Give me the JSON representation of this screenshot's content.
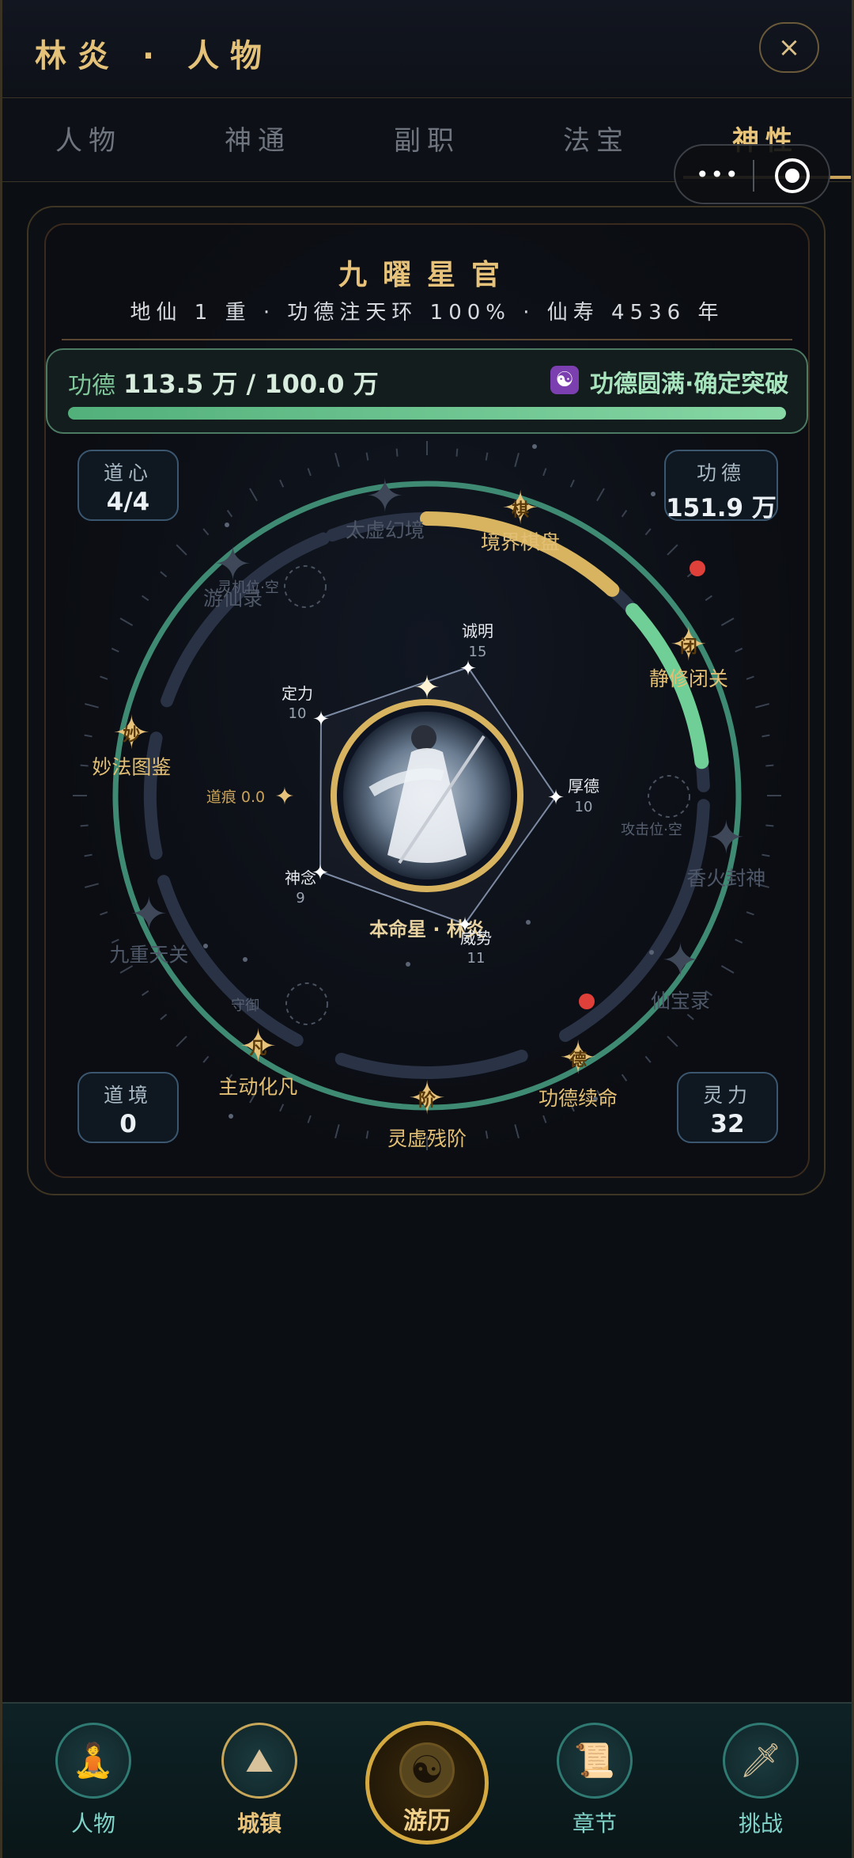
{
  "header": {
    "title": "林炎 · 人物",
    "close_label": "×"
  },
  "tabs": [
    "人物",
    "神通",
    "副职",
    "法宝",
    "神性"
  ],
  "active_tab": 4,
  "capsule": {
    "more_label": "•••"
  },
  "rank": {
    "title": "九曜星官",
    "subtitle": "地仙 1 重 · 功德注天环 100% · 仙寿 4536 年"
  },
  "merit": {
    "label": "功德",
    "value": "113.5 万 / 100.0 万",
    "action": "功德圆满·确定突破",
    "progress": 1.0
  },
  "stats": {
    "daoxin": {
      "label": "道心",
      "value": "4/4"
    },
    "gongde": {
      "label": "功德",
      "value": "151.9 万"
    },
    "daojing": {
      "label": "道境",
      "value": "0"
    },
    "lingli": {
      "label": "灵力",
      "value": "32"
    }
  },
  "wheel": {
    "center_label": "本命星 · 林炎",
    "daohen": "道痕 0.0",
    "attributes": [
      {
        "name": "诚明",
        "value": "15"
      },
      {
        "name": "厚德",
        "value": "10"
      },
      {
        "name": "威势",
        "value": "11"
      },
      {
        "name": "神念",
        "value": "9"
      },
      {
        "name": "定力",
        "value": "10"
      }
    ],
    "nodes": [
      {
        "name": "太虚幻境",
        "glyph": "",
        "active": false
      },
      {
        "name": "境界棋盘",
        "glyph": "棋",
        "active": true
      },
      {
        "name": "静修闭关",
        "glyph": "闭",
        "active": true
      },
      {
        "name": "香火封神",
        "glyph": "",
        "active": false
      },
      {
        "name": "仙宝录",
        "glyph": "",
        "active": false
      },
      {
        "name": "功德续命",
        "glyph": "德",
        "active": true
      },
      {
        "name": "灵虚残阶",
        "glyph": "阶",
        "active": true
      },
      {
        "name": "主动化凡",
        "glyph": "凡",
        "active": true
      },
      {
        "name": "九重天关",
        "glyph": "",
        "active": false
      },
      {
        "name": "妙法图鉴",
        "glyph": "妙",
        "active": true
      },
      {
        "name": "游仙录",
        "glyph": "",
        "active": false
      }
    ],
    "slots": [
      {
        "label": "灵机位·空"
      },
      {
        "label": "攻击位·空"
      },
      {
        "label": "守御"
      }
    ]
  },
  "nav": [
    {
      "label": "人物",
      "icon": "character-icon"
    },
    {
      "label": "城镇",
      "icon": "town-icon"
    },
    {
      "label": "游历",
      "icon": "yin-yang-icon"
    },
    {
      "label": "章节",
      "icon": "scroll-icon"
    },
    {
      "label": "挑战",
      "icon": "sword-icon"
    }
  ],
  "colors": {
    "gold": "#e6c27b",
    "jade": "#6fcf97",
    "dark": "#0b0e13",
    "alert": "#e0403a"
  }
}
